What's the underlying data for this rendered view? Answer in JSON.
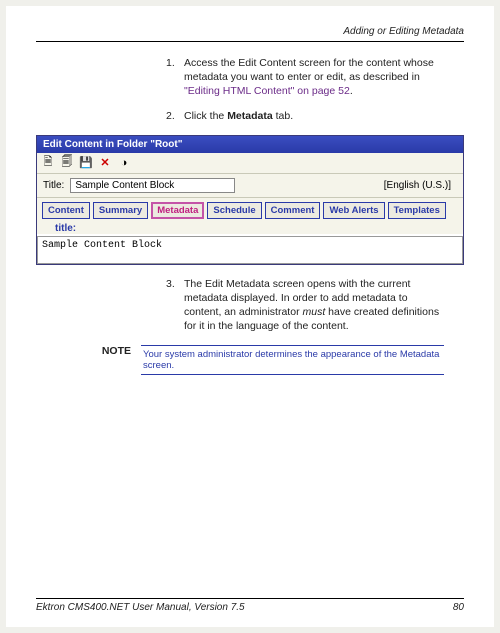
{
  "header": {
    "title": "Adding or Editing Metadata"
  },
  "steps": {
    "s1_num": "1.",
    "s1_text_a": "Access the Edit Content screen for the content whose metadata you want to enter or edit, as described in ",
    "s1_link": "\"Editing HTML Content\" on page 52",
    "s1_text_b": ".",
    "s2_num": "2.",
    "s2_text_a": "Click the ",
    "s2_bold": "Metadata",
    "s2_text_b": " tab.",
    "s3_num": "3.",
    "s3_text_a": "The Edit Metadata screen opens with the current metadata displayed. In order to add metadata to content, an administrator ",
    "s3_italic": "must",
    "s3_text_b": " have created definitions for it in the language of the content."
  },
  "window": {
    "titlebar": "Edit Content in Folder \"Root\"",
    "title_label": "Title:",
    "title_value": "Sample Content Block",
    "language": "[English (U.S.)]",
    "tabs": {
      "content": "Content",
      "summary": "Summary",
      "metadata": "Metadata",
      "schedule": "Schedule",
      "comment": "Comment",
      "web_alerts": "Web Alerts",
      "templates": "Templates"
    },
    "field_label": "title:",
    "field_value": "Sample Content Block"
  },
  "note": {
    "label": "NOTE",
    "body": "Your system administrator determines the appearance of the Metadata screen."
  },
  "footer": {
    "left": "Ektron CMS400.NET User Manual, Version 7.5",
    "right": "80"
  }
}
